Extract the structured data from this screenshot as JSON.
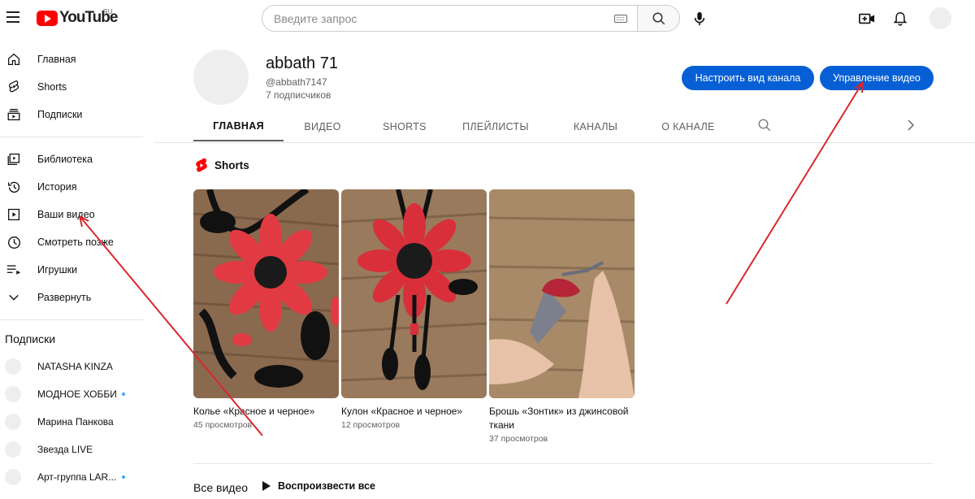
{
  "header": {
    "logo_text": "YouTube",
    "logo_region": "RU",
    "search_placeholder": "Введите запрос",
    "icons": [
      "menu-icon",
      "keyboard-icon",
      "search-icon",
      "mic-icon",
      "create-video-icon",
      "bell-icon"
    ]
  },
  "sidebar": {
    "items": [
      {
        "label": "Главная",
        "icon": "home-icon"
      },
      {
        "label": "Shorts",
        "icon": "shorts-icon"
      },
      {
        "label": "Подписки",
        "icon": "subscriptions-icon"
      }
    ],
    "library_items": [
      {
        "label": "Библиотека",
        "icon": "library-icon"
      },
      {
        "label": "История",
        "icon": "history-icon"
      },
      {
        "label": "Ваши видео",
        "icon": "your-videos-icon"
      },
      {
        "label": "Смотреть позже",
        "icon": "watch-later-icon"
      },
      {
        "label": "Игрушки",
        "icon": "playlist-icon"
      },
      {
        "label": "Развернуть",
        "icon": "chevron-down-icon"
      }
    ],
    "subscriptions_heading": "Подписки",
    "subscriptions": [
      {
        "label": "NATASHA KINZA",
        "new": false
      },
      {
        "label": "МОДНОЕ ХОББИ",
        "new": true
      },
      {
        "label": "Марина Панкова",
        "new": false
      },
      {
        "label": "Звезда LIVE",
        "new": false
      },
      {
        "label": "Арт-группа LAR...",
        "new": true
      }
    ]
  },
  "channel": {
    "name": "abbath 71",
    "handle": "@abbath7147",
    "subscribers": "7 подписчиков",
    "customize_label": "Настроить вид канала",
    "manage_label": "Управление видео"
  },
  "tabs": [
    "ГЛАВНАЯ",
    "ВИДЕО",
    "SHORTS",
    "ПЛЕЙЛИСТЫ",
    "КАНАЛЫ",
    "О КАНАЛЕ"
  ],
  "active_tab": "ГЛАВНАЯ",
  "shorts": {
    "heading": "Shorts",
    "items": [
      {
        "title": "Колье «Красное и черное»",
        "views": "45 просмотров"
      },
      {
        "title": "Кулон «Красное и черное»",
        "views": "12 просмотров"
      },
      {
        "title": "Брошь «Зонтик» из джинсовой ткани",
        "views": "37 просмотров"
      }
    ]
  },
  "all_videos": {
    "heading": "Все видео",
    "play_all_label": "Воспроизвести все"
  },
  "colors": {
    "brand_red": "#ff0000",
    "button_blue": "#065fd4",
    "annotation_red": "#d9272e"
  }
}
